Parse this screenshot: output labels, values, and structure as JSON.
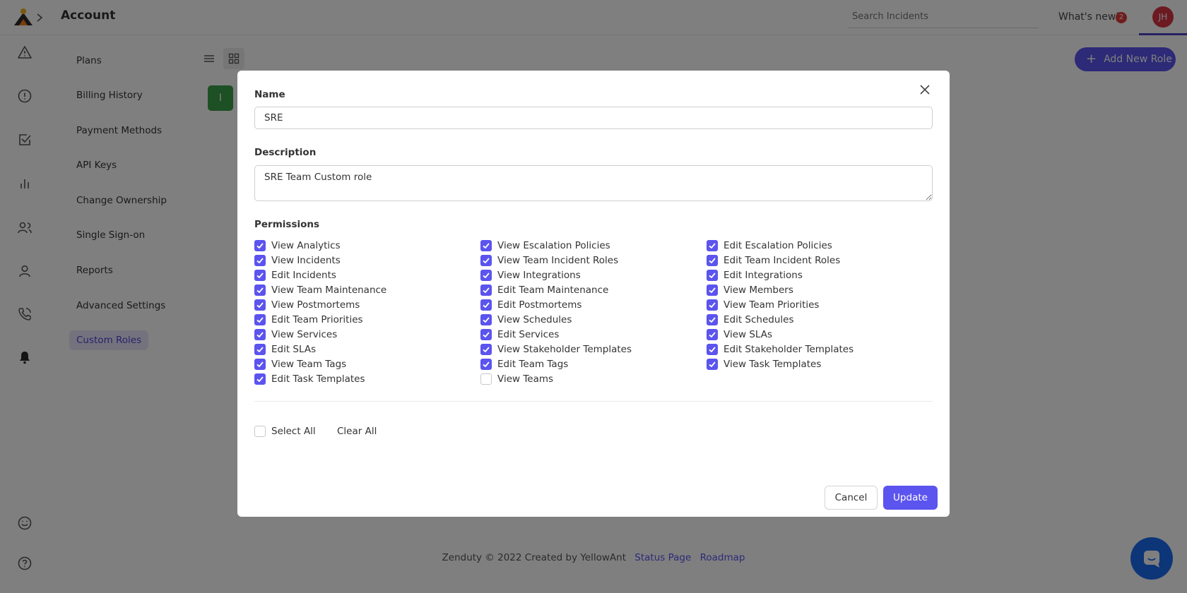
{
  "header": {
    "page_title": "Account",
    "search_placeholder": "Search Incidents",
    "whats_new_label": "What's new?",
    "whats_new_count": "2",
    "user_initials": "JH"
  },
  "rail": {
    "icons": [
      "alert-triangle-icon",
      "alert-circle-icon",
      "checkbox-icon",
      "bar-chart-icon",
      "users-icon",
      "user-icon",
      "phone-icon",
      "bell-icon",
      "smile-icon",
      "help-circle-icon"
    ]
  },
  "account_menu": {
    "items": [
      {
        "label": "Plans"
      },
      {
        "label": "Billing History"
      },
      {
        "label": "Payment Methods"
      },
      {
        "label": "API Keys"
      },
      {
        "label": "Change Ownership"
      },
      {
        "label": "Single Sign-on"
      },
      {
        "label": "Reports"
      },
      {
        "label": "Advanced Settings"
      },
      {
        "label": "Custom Roles",
        "active": true
      }
    ]
  },
  "content": {
    "tile_letter": "I",
    "add_role_label": "Add New Role"
  },
  "footer": {
    "copyright": "Zenduty © 2022 Created by YellowAnt",
    "status_page_label": "Status Page",
    "roadmap_label": "Roadmap"
  },
  "modal": {
    "name_label": "Name",
    "name_value": "SRE",
    "description_label": "Description",
    "description_value": "SRE Team Custom role",
    "permissions_label": "Permissions",
    "permission_columns": [
      [
        {
          "label": "View Analytics",
          "checked": true
        },
        {
          "label": "View Incidents",
          "checked": true
        },
        {
          "label": "Edit Incidents",
          "checked": true
        },
        {
          "label": "View Team Maintenance",
          "checked": true
        },
        {
          "label": "View Postmortems",
          "checked": true
        },
        {
          "label": "Edit Team Priorities",
          "checked": true
        },
        {
          "label": "View Services",
          "checked": true
        },
        {
          "label": "Edit SLAs",
          "checked": true
        },
        {
          "label": "View Team Tags",
          "checked": true
        },
        {
          "label": "Edit Task Templates",
          "checked": true
        }
      ],
      [
        {
          "label": "View Escalation Policies",
          "checked": true
        },
        {
          "label": "View Team Incident Roles",
          "checked": true
        },
        {
          "label": "View Integrations",
          "checked": true
        },
        {
          "label": "Edit Team Maintenance",
          "checked": true
        },
        {
          "label": "Edit Postmortems",
          "checked": true
        },
        {
          "label": "View Schedules",
          "checked": true
        },
        {
          "label": "Edit Services",
          "checked": true
        },
        {
          "label": "View Stakeholder Templates",
          "checked": true
        },
        {
          "label": "Edit Team Tags",
          "checked": true
        },
        {
          "label": "View Teams",
          "checked": false
        }
      ],
      [
        {
          "label": "Edit Escalation Policies",
          "checked": true
        },
        {
          "label": "Edit Team Incident Roles",
          "checked": true
        },
        {
          "label": "Edit Integrations",
          "checked": true
        },
        {
          "label": "View Members",
          "checked": true
        },
        {
          "label": "View Team Priorities",
          "checked": true
        },
        {
          "label": "Edit Schedules",
          "checked": true
        },
        {
          "label": "View SLAs",
          "checked": true
        },
        {
          "label": "Edit Stakeholder Templates",
          "checked": true
        },
        {
          "label": "View Task Templates",
          "checked": true
        }
      ]
    ],
    "select_all_label": "Select All",
    "select_all_checked": false,
    "clear_all_label": "Clear All",
    "cancel_label": "Cancel",
    "update_label": "Update"
  },
  "colors": {
    "accent": "#5b54ee",
    "overlay": "rgba(0,0,0,0.5)",
    "tile_green": "#3aa149",
    "avatar_red": "#d93445",
    "chat_blue": "#1a6cf2"
  }
}
